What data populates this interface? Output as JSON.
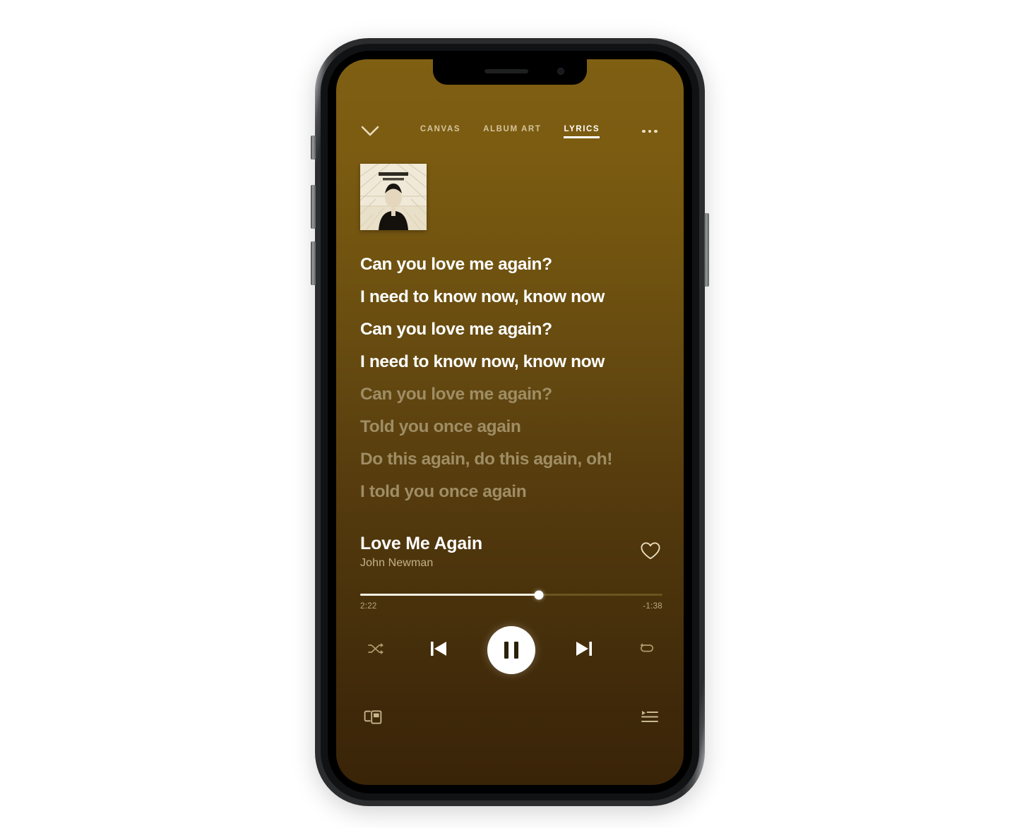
{
  "app": {
    "name": "Spotify Now Playing",
    "device": "iPhone X"
  },
  "theme": {
    "bg_top": "#7f5f12",
    "bg_bottom": "#3a2408",
    "accent_white": "#ffffff",
    "dim_text": "#9f8d65",
    "muted_text": "#c3b28c",
    "tab_inactive": "#d4c39c"
  },
  "topnav": {
    "collapse_icon": "chevron-down-icon",
    "more_icon": "ellipsis-icon",
    "tabs": [
      {
        "label": "CANVAS",
        "active": false
      },
      {
        "label": "ALBUM ART",
        "active": false
      },
      {
        "label": "LYRICS",
        "active": true
      }
    ]
  },
  "cover": {
    "alt": "album-artwork",
    "artist_line": "JOHN NEWMAN",
    "title_line": "TRIBUTE"
  },
  "lyrics": {
    "lines": [
      {
        "text": "Can you love me again?",
        "state": "sung"
      },
      {
        "text": "I need to know now, know now",
        "state": "sung"
      },
      {
        "text": "Can you love me again?",
        "state": "sung"
      },
      {
        "text": "I need to know now, know now",
        "state": "sung"
      },
      {
        "text": "Can you love me again?",
        "state": "unsung"
      },
      {
        "text": "Told you once again",
        "state": "unsung"
      },
      {
        "text": "Do this again, do this again, oh!",
        "state": "unsung"
      },
      {
        "text": "I told you once again",
        "state": "unsung"
      }
    ]
  },
  "now_playing": {
    "title": "Love Me Again",
    "artist": "John Newman",
    "like_icon": "heart-outline-icon",
    "liked": false
  },
  "progress": {
    "elapsed": "2:22",
    "remaining": "-1:38",
    "percent": 59
  },
  "controls": {
    "shuffle": {
      "icon": "shuffle-icon",
      "label": "Shuffle",
      "active": false
    },
    "previous": {
      "icon": "skip-previous-icon",
      "label": "Previous"
    },
    "play_pause": {
      "icon": "pause-icon",
      "label": "Pause",
      "state": "playing"
    },
    "next": {
      "icon": "skip-next-icon",
      "label": "Next"
    },
    "repeat": {
      "icon": "repeat-icon",
      "label": "Repeat",
      "active": false
    }
  },
  "bottombar": {
    "devices": {
      "icon": "devices-connect-icon",
      "label": "Connect to a device"
    },
    "queue": {
      "icon": "queue-list-icon",
      "label": "Queue"
    }
  }
}
